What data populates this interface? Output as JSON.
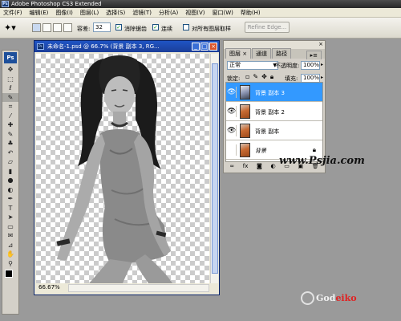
{
  "app": {
    "title": "Adobe Photoshop CS3 Extended",
    "badge": "Ps"
  },
  "menubar": {
    "items": [
      "文件(F)",
      "编辑(E)",
      "图像(I)",
      "图层(L)",
      "选择(S)",
      "滤镜(T)",
      "分析(A)",
      "视图(V)",
      "窗口(W)",
      "帮助(H)"
    ]
  },
  "options": {
    "tool_icon": "magic-wand-icon",
    "tolerance_label": "容差:",
    "tolerance_value": "32",
    "antialias_label": "消除锯齿",
    "antialias_checked": true,
    "contiguous_label": "连续",
    "contiguous_checked": true,
    "sample_all_label": "对所有图层取样",
    "sample_all_checked": false,
    "refine_edge_label": "Refine Edge..."
  },
  "tools": {
    "logo": "Ps",
    "items": [
      {
        "name": "move-icon",
        "glyph": "✥"
      },
      {
        "name": "marquee-icon",
        "glyph": "⬚"
      },
      {
        "name": "lasso-icon",
        "glyph": "ℓ"
      },
      {
        "name": "magic-wand-icon",
        "glyph": "✎"
      },
      {
        "name": "crop-icon",
        "glyph": "⌗"
      },
      {
        "name": "slice-icon",
        "glyph": "⁄"
      },
      {
        "name": "healing-brush-icon",
        "glyph": "✚"
      },
      {
        "name": "brush-icon",
        "glyph": "✎"
      },
      {
        "name": "clone-stamp-icon",
        "glyph": "♣"
      },
      {
        "name": "history-brush-icon",
        "glyph": "↶"
      },
      {
        "name": "eraser-icon",
        "glyph": "▱"
      },
      {
        "name": "gradient-icon",
        "glyph": "▮"
      },
      {
        "name": "blur-icon",
        "glyph": "●"
      },
      {
        "name": "dodge-icon",
        "glyph": "◐"
      },
      {
        "name": "pen-icon",
        "glyph": "✒"
      },
      {
        "name": "type-icon",
        "glyph": "T"
      },
      {
        "name": "path-selection-icon",
        "glyph": "➤"
      },
      {
        "name": "shape-icon",
        "glyph": "▭"
      },
      {
        "name": "notes-icon",
        "glyph": "✉"
      },
      {
        "name": "eyedropper-icon",
        "glyph": "⊿"
      },
      {
        "name": "hand-icon",
        "glyph": "✋"
      },
      {
        "name": "zoom-icon",
        "glyph": "⚲"
      }
    ],
    "selected_index": 3
  },
  "document": {
    "title": "未命名-1.psd @ 66.7% (背景 副本 3, RG...",
    "icon": "Ps",
    "zoom_status": "66.67%"
  },
  "layers_panel": {
    "tabs": [
      "图层 ×",
      "通道",
      "路径"
    ],
    "blend_mode": "正常",
    "opacity_label": "不透明度:",
    "opacity_value": "100%",
    "lock_label": "锁定:",
    "fill_label": "填充:",
    "fill_value": "100%",
    "layers": [
      {
        "name": "背景 副本 3",
        "visible": true,
        "selected": true,
        "thumb": "gray",
        "locked": false,
        "italic": false
      },
      {
        "name": "背景 副本 2",
        "visible": true,
        "selected": false,
        "thumb": "color",
        "locked": false,
        "italic": false
      },
      {
        "name": "背景 副本",
        "visible": true,
        "selected": false,
        "thumb": "color",
        "locked": false,
        "italic": false
      },
      {
        "name": "背景",
        "visible": false,
        "selected": false,
        "thumb": "color",
        "locked": true,
        "italic": true
      }
    ],
    "footer_icons": [
      "link-icon",
      "fx-icon",
      "mask-icon",
      "adjustment-icon",
      "folder-icon",
      "new-layer-icon",
      "trash-icon"
    ]
  },
  "watermarks": {
    "site": "www.Psjia.com",
    "brand_a": "God",
    "brand_b": "eiko"
  },
  "colors": {
    "workspace": "#9a9a9a",
    "selection": "#3399ff",
    "titlebar": "#1f54c4"
  }
}
